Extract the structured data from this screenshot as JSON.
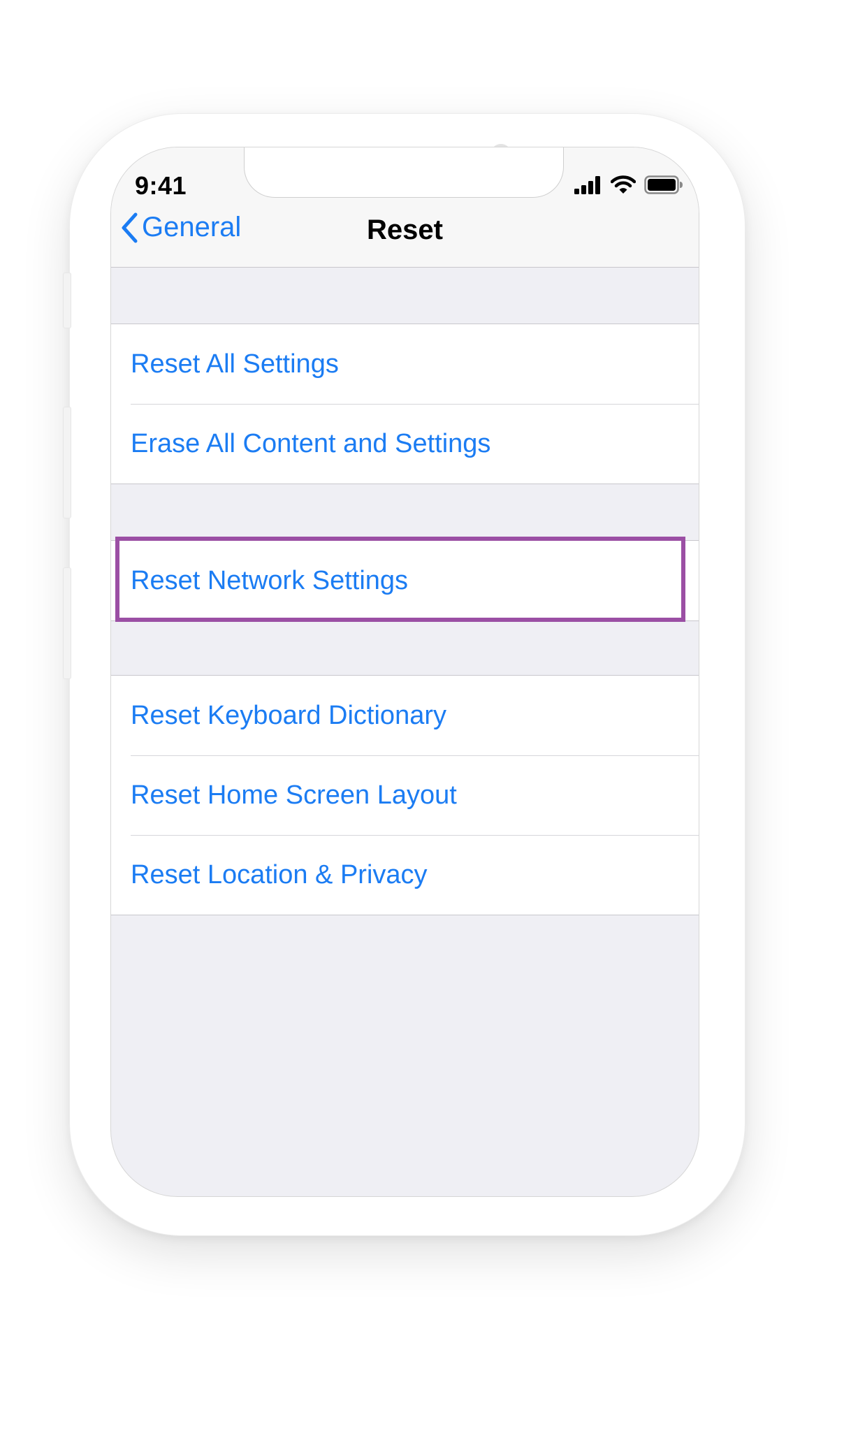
{
  "status_bar": {
    "time": "9:41"
  },
  "nav": {
    "back_label": "General",
    "title": "Reset"
  },
  "groups": [
    {
      "items": [
        {
          "label": "Reset All Settings"
        },
        {
          "label": "Erase All Content and Settings"
        }
      ]
    },
    {
      "items": [
        {
          "label": "Reset Network Settings",
          "highlighted": true
        }
      ]
    },
    {
      "items": [
        {
          "label": "Reset Keyboard Dictionary"
        },
        {
          "label": "Reset Home Screen Layout"
        },
        {
          "label": "Reset Location & Privacy"
        }
      ]
    }
  ],
  "colors": {
    "accent": "#1b7cf3",
    "highlight_border": "#9b4fa4",
    "screen_background": "#efeff4"
  },
  "icons": {
    "back": "chevron-left-icon",
    "signal": "cellular-signal-icon",
    "wifi": "wifi-icon",
    "battery": "battery-icon"
  }
}
